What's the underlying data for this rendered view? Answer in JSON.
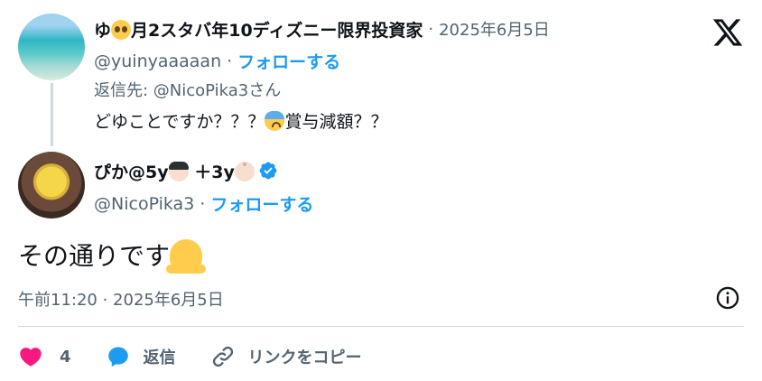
{
  "reply_tweet": {
    "author_name_prefix": "ゆ",
    "author_name_emoji": "pleading-face-icon",
    "author_name_suffix": "月2スタバ年10ディズニー限界投資家",
    "date": "2025年6月5日",
    "handle": "@yuinyaaaaan",
    "follow_label": "フォローする",
    "reply_to": "返信先: @NicoPika3さん",
    "text_before_emoji": "どゆことですか？？？",
    "text_emoji": "anxious-face-icon",
    "text_after_emoji": "賞与減額？？"
  },
  "main_tweet": {
    "author_name_part1": "ぴか@5y",
    "author_name_part2": "＋3y",
    "verified": true,
    "handle": "@NicoPika3",
    "follow_label": "フォローする",
    "text": "その通りです",
    "text_emoji": "melting-face-icon",
    "timestamp": "午前11:20 · 2025年6月5日"
  },
  "actions": {
    "like_count": "4",
    "reply_label": "返信",
    "copy_link_label": "リンクをコピー"
  },
  "colors": {
    "text_primary": "#0f1419",
    "text_secondary": "#536471",
    "accent_blue": "#1d9bf0",
    "like_pink": "#f91880",
    "divider": "#cfd9de"
  }
}
